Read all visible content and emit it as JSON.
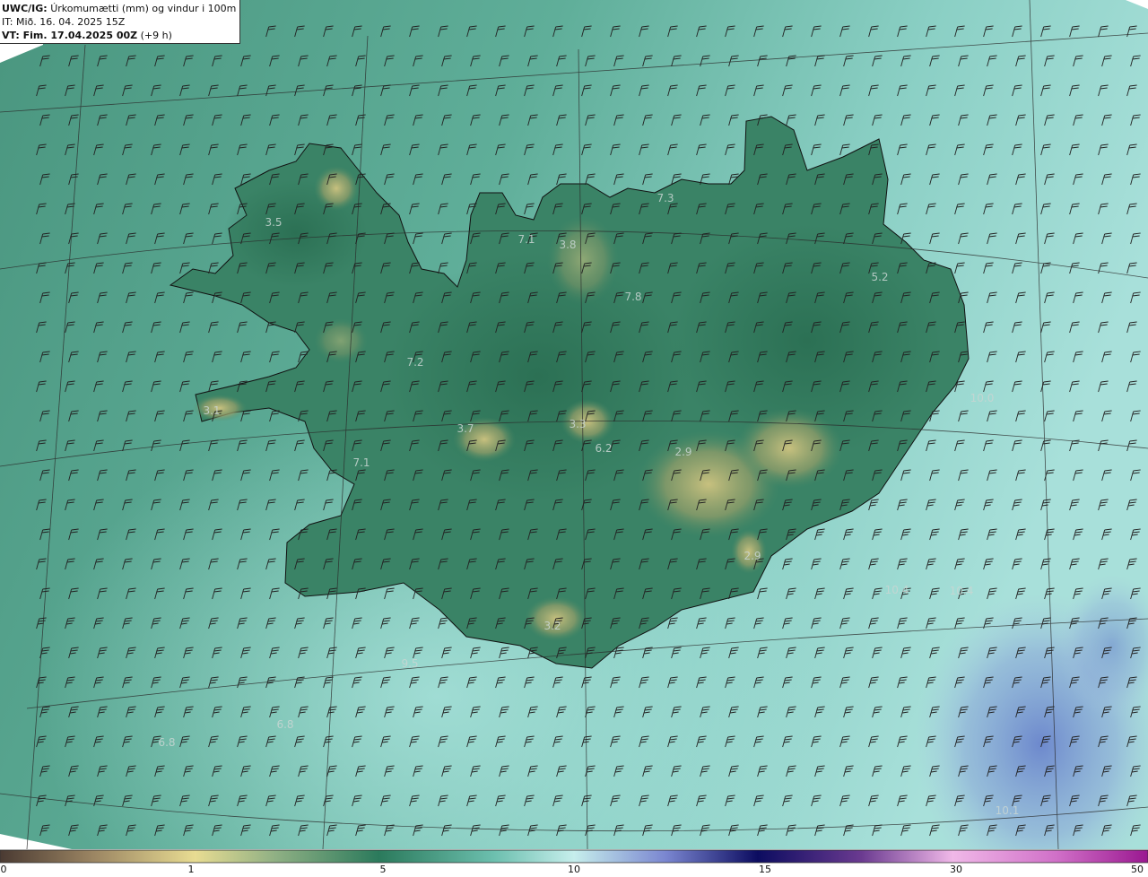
{
  "header": {
    "model_label": "UWC/IG:",
    "field_title": "Úrkomumætti (mm) og vindur i 100m hæð",
    "it_line": "IT: Mið. 16. 04. 2025 15Z",
    "vt_label": "VT: Fim. 17.04.2025 00Z",
    "vt_offset": "(+9 h)"
  },
  "colorbar": {
    "ticks": [
      "0",
      "1",
      "5",
      "10",
      "15",
      "30",
      "50"
    ],
    "colors": [
      "#55443a",
      "#a8936a",
      "#e8da8e",
      "#2b7a5c",
      "#bde8e6",
      "#5a68c0",
      "#101060",
      "#d088c8",
      "#9a1890"
    ]
  },
  "map": {
    "background_colors": {
      "sea_west": "#4e9b87",
      "sea_east": "#9ed8d0",
      "land": "#357c5e",
      "highland": "#b8b070",
      "heavy_precip": "#7898cc",
      "coast_line": "#111111",
      "barb_color": "#222222"
    },
    "values": [
      "3.5",
      "7.1",
      "3.8",
      "7.3",
      "5.2",
      "7.8",
      "7.2",
      "10.0",
      "3.1",
      "3.7",
      "3.3",
      "6.2",
      "2.9",
      "7.1",
      "2.9",
      "10.4",
      "10.4",
      "3.2",
      "9.5",
      "6.8",
      "6.8",
      "10.1"
    ]
  }
}
